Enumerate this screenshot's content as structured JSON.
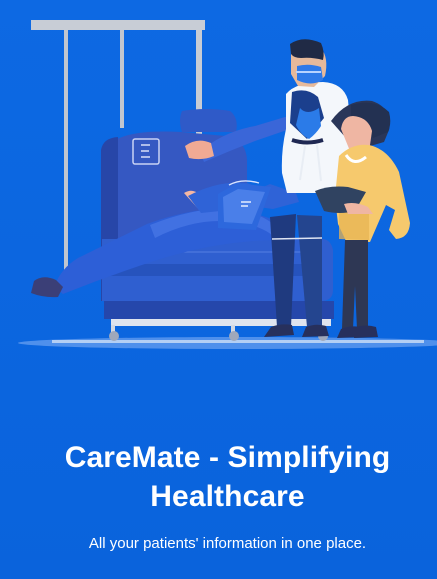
{
  "onboarding": {
    "title": "CareMate - Simplifying Healthcare",
    "subtitle": "All your patients' information in one place."
  },
  "illustration": {
    "subject": "doctor-and-nurse-with-patient-in-hospital-bed"
  },
  "colors": {
    "background": "#0b67e0",
    "text": "#ffffff",
    "bed_blue": "#2f5dcc",
    "nurse_yellow": "#f6c96d"
  }
}
